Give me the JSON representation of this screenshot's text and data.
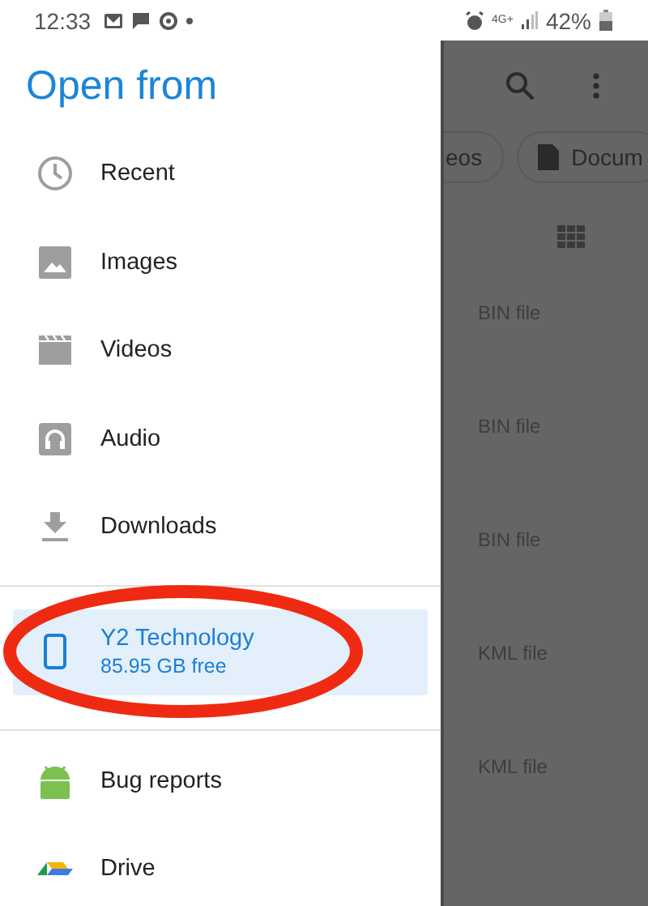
{
  "status_bar": {
    "time": "12:33",
    "network": "4G+",
    "battery": "42%"
  },
  "drawer": {
    "title": "Open from",
    "groups": [
      {
        "items": [
          {
            "label": "Recent",
            "selected": false
          },
          {
            "label": "Images",
            "selected": false
          },
          {
            "label": "Videos",
            "selected": false
          },
          {
            "label": "Audio",
            "selected": false
          },
          {
            "label": "Downloads",
            "selected": false
          }
        ]
      },
      {
        "items": [
          {
            "label": "Y2 Technology",
            "subtitle": "85.95 GB free",
            "selected": true
          }
        ]
      },
      {
        "items": [
          {
            "label": "Bug reports",
            "selected": false
          },
          {
            "label": "Drive",
            "selected": false
          }
        ]
      }
    ]
  },
  "background": {
    "chips": [
      "eos",
      "Docum"
    ],
    "files": [
      "BIN file",
      "BIN file",
      "BIN file",
      "KML file",
      "KML file"
    ]
  }
}
